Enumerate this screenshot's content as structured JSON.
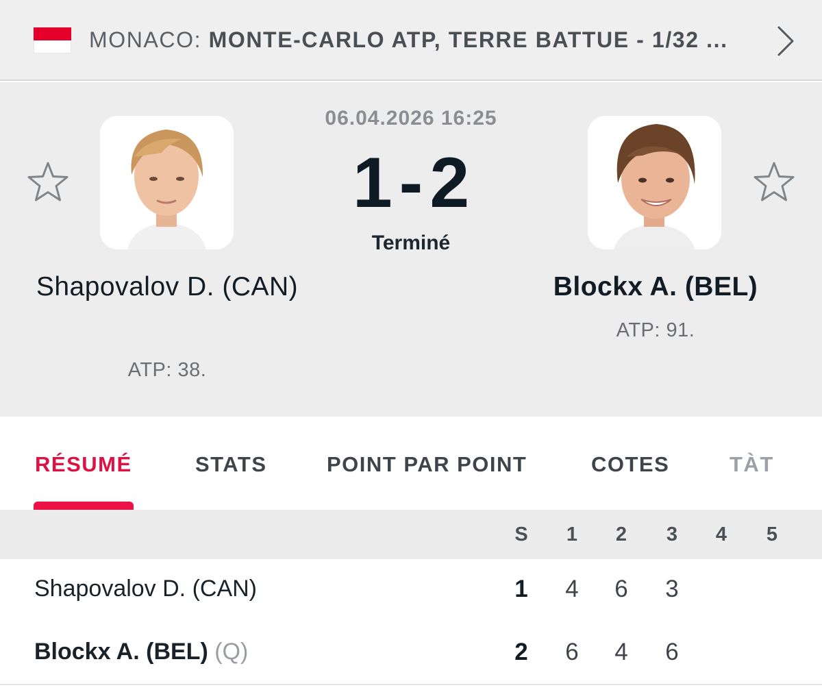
{
  "league": {
    "country": "MONACO:",
    "name": "MONTE-CARLO ATP, TERRE BATTUE - 1/32 ...",
    "flag_colors": [
      "#e4002b",
      "#ffffff"
    ]
  },
  "match": {
    "datetime": "06.04.2026 16:25",
    "score_home": "1",
    "score_separator": "-",
    "score_away": "2",
    "status": "Terminé"
  },
  "home": {
    "name": "Shapovalov D. (CAN)",
    "rank": "ATP: 38."
  },
  "away": {
    "name": "Blockx A. (BEL)",
    "rank": "ATP: 91."
  },
  "tabs": [
    {
      "label": "RÉSUMÉ",
      "active": true
    },
    {
      "label": "STATS",
      "active": false
    },
    {
      "label": "POINT PAR POINT",
      "active": false
    },
    {
      "label": "COTES",
      "active": false
    },
    {
      "label": "TÀT",
      "active": false
    }
  ],
  "scoreboard": {
    "headers": [
      "S",
      "1",
      "2",
      "3",
      "4",
      "5"
    ],
    "rows": [
      {
        "name": "Shapovalov D. (CAN)",
        "qualifier": "",
        "sets": "1",
        "games": [
          "4",
          "6",
          "3"
        ]
      },
      {
        "name": "Blockx A. (BEL)",
        "qualifier": "(Q)",
        "sets": "2",
        "games": [
          "6",
          "4",
          "6"
        ]
      }
    ]
  },
  "colors": {
    "accent": "#ec1147",
    "header_bg": "#ededed",
    "text_dark": "#111c24"
  }
}
